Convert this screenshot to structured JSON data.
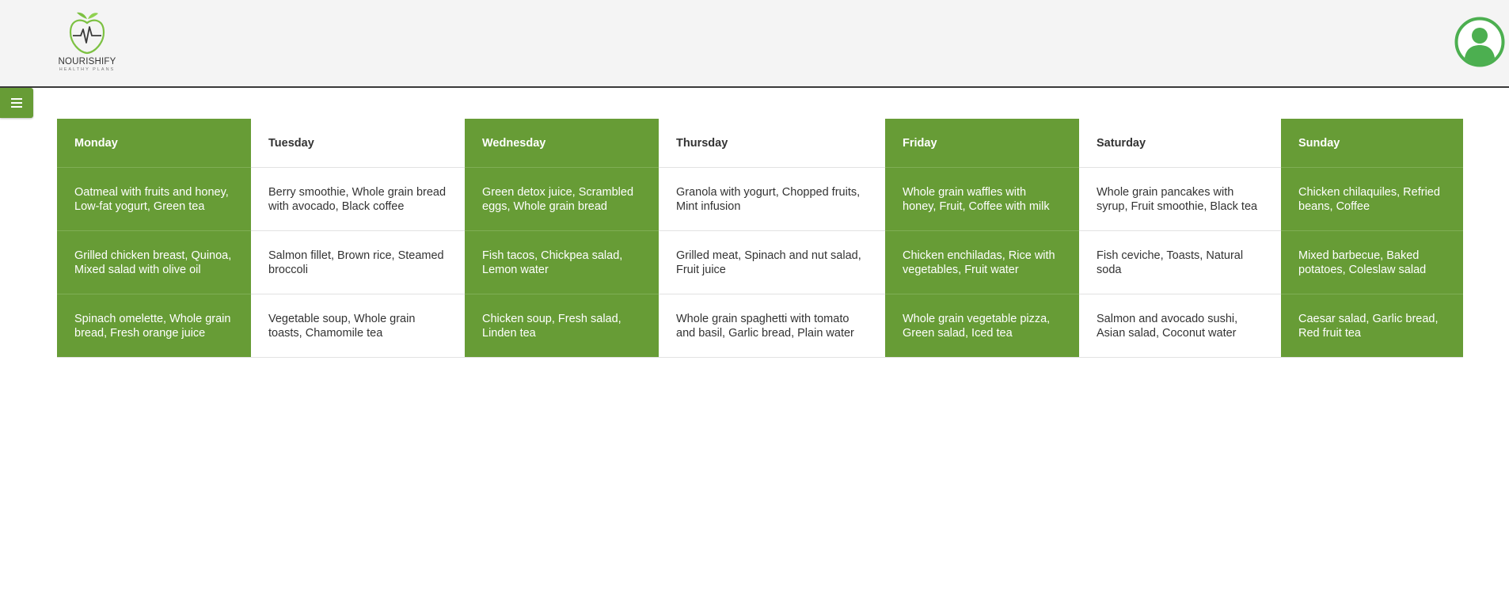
{
  "brand": {
    "name": "NOURISHIFY",
    "tagline": "HEALTHY PLANS",
    "logo_icon": "apple-heartbeat-icon",
    "accent_color": "#679c36"
  },
  "header": {
    "avatar_icon": "user-avatar-icon"
  },
  "menu": {
    "icon": "hamburger-menu-icon"
  },
  "meal_plan": {
    "days": [
      "Monday",
      "Tuesday",
      "Wednesday",
      "Thursday",
      "Friday",
      "Saturday",
      "Sunday"
    ],
    "rows": [
      [
        "Oatmeal with fruits and honey, Low-fat yogurt, Green tea",
        "Berry smoothie, Whole grain bread with avocado, Black coffee",
        "Green detox juice, Scrambled eggs, Whole grain bread",
        "Granola with yogurt, Chopped fruits, Mint infusion",
        "Whole grain waffles with honey, Fruit, Coffee with milk",
        "Whole grain pancakes with syrup, Fruit smoothie, Black tea",
        "Chicken chilaquiles, Refried beans, Coffee"
      ],
      [
        "Grilled chicken breast, Quinoa, Mixed salad with olive oil",
        "Salmon fillet, Brown rice, Steamed broccoli",
        "Fish tacos, Chickpea salad, Lemon water",
        "Grilled meat, Spinach and nut salad, Fruit juice",
        "Chicken enchiladas, Rice with vegetables, Fruit water",
        "Fish ceviche, Toasts, Natural soda",
        "Mixed barbecue, Baked potatoes, Coleslaw salad"
      ],
      [
        "Spinach omelette, Whole grain bread, Fresh orange juice",
        "Vegetable soup, Whole grain toasts, Chamomile tea",
        "Chicken soup, Fresh salad, Linden tea",
        "Whole grain spaghetti with tomato and basil, Garlic bread, Plain water",
        "Whole grain vegetable pizza, Green salad, Iced tea",
        "Salmon and avocado sushi, Asian salad, Coconut water",
        "Caesar salad, Garlic bread, Red fruit tea"
      ]
    ]
  }
}
